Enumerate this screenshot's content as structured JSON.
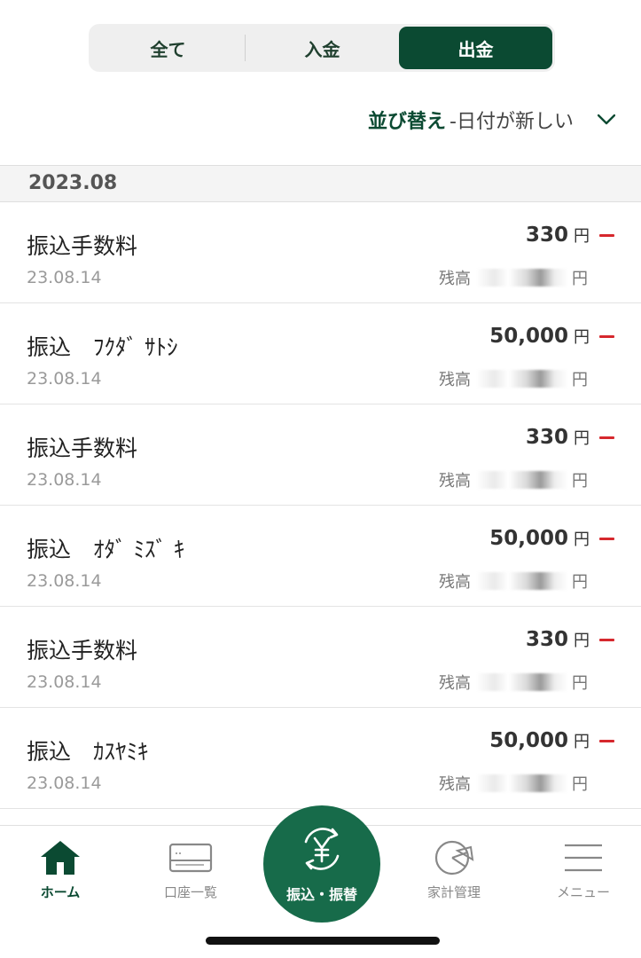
{
  "filter_tabs": [
    "全て",
    "入金",
    "出金"
  ],
  "sort": {
    "label": "並び替え",
    "value": "-日付が新しい"
  },
  "month_header": "2023.08",
  "transactions": [
    {
      "name": "振込手数料",
      "date": "23.08.14",
      "amount": "330",
      "currency": "円",
      "balance_label": "残高",
      "balance_currency": "円"
    },
    {
      "name": "振込　ﾌｸﾀﾞ ｻﾄｼ",
      "date": "23.08.14",
      "amount": "50,000",
      "currency": "円",
      "balance_label": "残高",
      "balance_currency": "円"
    },
    {
      "name": "振込手数料",
      "date": "23.08.14",
      "amount": "330",
      "currency": "円",
      "balance_label": "残高",
      "balance_currency": "円"
    },
    {
      "name": "振込　ｵﾀﾞ ﾐｽﾞ ｷ",
      "date": "23.08.14",
      "amount": "50,000",
      "currency": "円",
      "balance_label": "残高",
      "balance_currency": "円"
    },
    {
      "name": "振込手数料",
      "date": "23.08.14",
      "amount": "330",
      "currency": "円",
      "balance_label": "残高",
      "balance_currency": "円"
    },
    {
      "name": "振込　ｶｽﾔﾐｷ",
      "date": "23.08.14",
      "amount": "50,000",
      "currency": "円",
      "balance_label": "残高",
      "balance_currency": "円"
    }
  ],
  "tabbar": {
    "home": "ホーム",
    "accounts": "口座一覧",
    "transfer": "振込・振替",
    "budget": "家計管理",
    "menu": "メニュー"
  },
  "colors": {
    "brand_green": "#0b4a32",
    "center_green": "#176b4a",
    "minus_red": "#d6282d"
  },
  "icons": [
    "chevron-down-icon",
    "minus-icon",
    "home-icon",
    "card-icon",
    "yen-transfer-icon",
    "pie-chart-icon",
    "hamburger-menu-icon"
  ]
}
